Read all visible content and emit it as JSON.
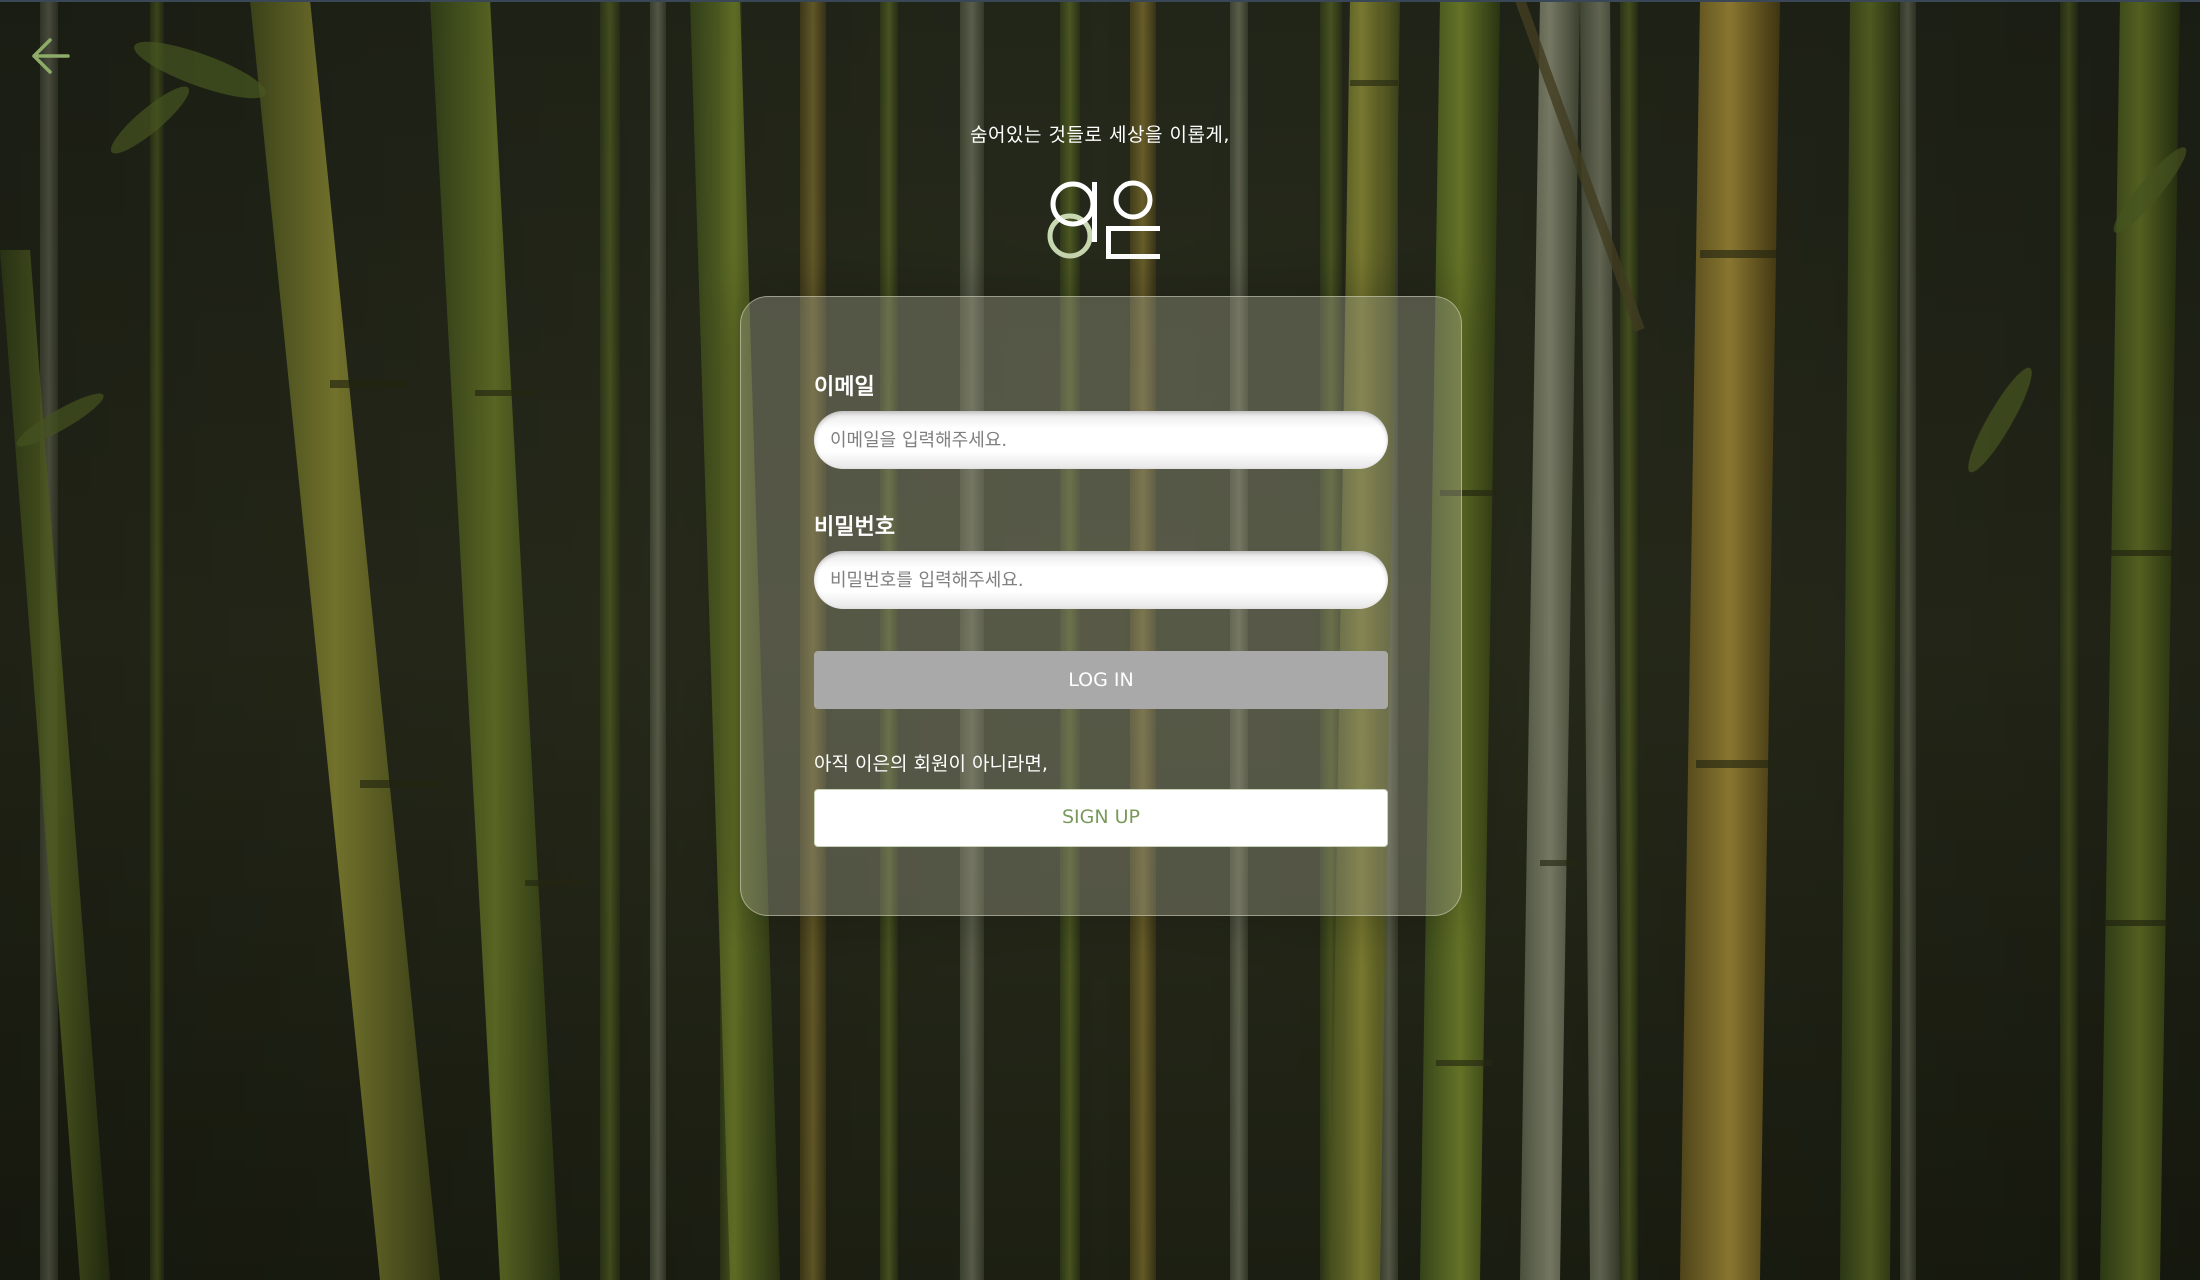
{
  "header": {
    "back_icon": "arrow-left-icon",
    "tagline": "숨어있는 것들로 세상을 이롭게,",
    "logo_text": "이은"
  },
  "login_form": {
    "email_label": "이메일",
    "email_placeholder": "이메일을 입력해주세요.",
    "email_value": "",
    "password_label": "비밀번호",
    "password_placeholder": "비밀번호를 입력해주세요.",
    "password_value": "",
    "login_label": "LOG IN",
    "signup_note": "아직 이은의 회원이 아니라면,",
    "signup_label": "SIGN UP"
  },
  "colors": {
    "accent_green": "#7a9a5c",
    "logo_ring": "#c8d8b0",
    "login_disabled": "#a9a9a9"
  }
}
